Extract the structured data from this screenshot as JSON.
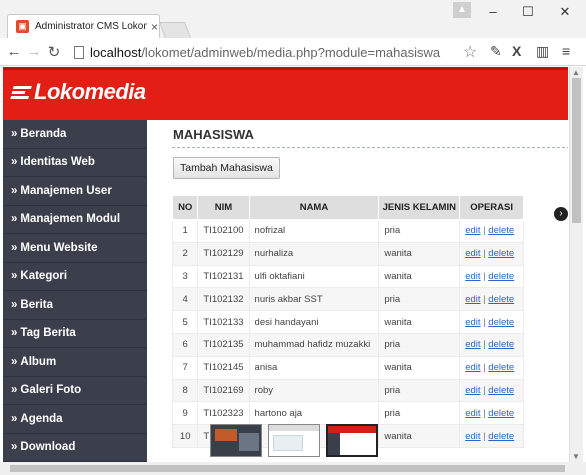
{
  "browser": {
    "tab_title": "Administrator CMS Lokom",
    "tab_close": "×",
    "favicon": "favicon-cms",
    "url_host": "localhost",
    "url_path": "/lokomet/adminweb/media.php?module=mahasiswa",
    "window_minimize": "–",
    "window_maximize": "☐",
    "window_close": "✕",
    "profile": "👤"
  },
  "site": {
    "logo_text": "Lokomedia",
    "brand_color": "#e31e14"
  },
  "sidebar": {
    "items": [
      {
        "label": "Beranda"
      },
      {
        "label": "Identitas Web"
      },
      {
        "label": "Manajemen User"
      },
      {
        "label": "Manajemen Modul"
      },
      {
        "label": "Menu Website"
      },
      {
        "label": "Kategori"
      },
      {
        "label": "Berita"
      },
      {
        "label": "Tag Berita"
      },
      {
        "label": "Album"
      },
      {
        "label": "Galeri Foto"
      },
      {
        "label": "Agenda"
      },
      {
        "label": "Download"
      }
    ],
    "arrow": "»"
  },
  "main": {
    "heading": "MAHASISWA",
    "add_button": "Tambah Mahasiswa",
    "columns": [
      "NO",
      "NIM",
      "NAMA",
      "JENIS KELAMIN",
      "OPERASI"
    ],
    "edit_label": "edit",
    "delete_label": "delete",
    "op_sep": "|",
    "rows": [
      {
        "no": "1",
        "nim": "TI102100",
        "nama": "nofrizal",
        "jk": "pria"
      },
      {
        "no": "2",
        "nim": "TI102129",
        "nama": "nurhaliza",
        "jk": "wanita"
      },
      {
        "no": "3",
        "nim": "TI102131",
        "nama": "ulfi oktafiani",
        "jk": "wanita"
      },
      {
        "no": "4",
        "nim": "TI102132",
        "nama": "nuris akbar SST",
        "jk": "pria"
      },
      {
        "no": "5",
        "nim": "TI102133",
        "nama": "desi handayani",
        "jk": "wanita"
      },
      {
        "no": "6",
        "nim": "TI102135",
        "nama": "muhammad hafidz muzakki",
        "jk": "pria"
      },
      {
        "no": "7",
        "nim": "TI102145",
        "nama": "anisa",
        "jk": "wanita"
      },
      {
        "no": "8",
        "nim": "TI102169",
        "nama": "roby",
        "jk": "pria"
      },
      {
        "no": "9",
        "nim": "TI102323",
        "nama": "hartono aja",
        "jk": "pria"
      },
      {
        "no": "10",
        "nim": "TI",
        "nama": "",
        "jk": "wanita"
      }
    ]
  }
}
